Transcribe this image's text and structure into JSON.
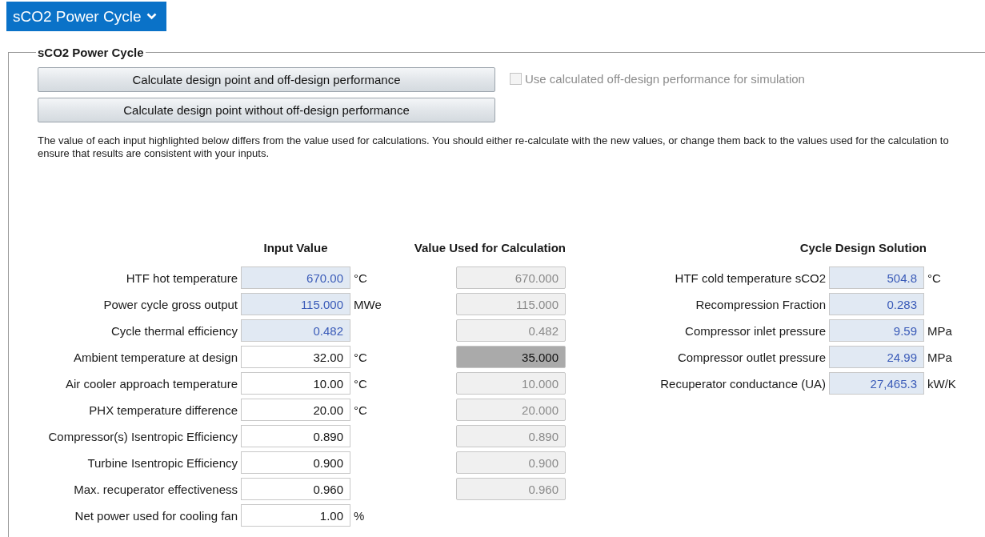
{
  "header_tab": {
    "label": "sCO2 Power Cycle",
    "selected": true
  },
  "group": {
    "title": "sCO2 Power Cycle"
  },
  "buttons": [
    "Calculate design point and off-design performance",
    "Calculate design point without off-design performance"
  ],
  "option": {
    "label": "Use calculated off-design performance for simulation",
    "checked": false,
    "disabled": true
  },
  "notice": "The value of each input highlighted below differs from the value used for calculations. You should either re-calculate with the new values, or change them back to the values used for the calculation to ensure that results are consistent with your inputs.",
  "inputs": {
    "columns": [
      "Input Value",
      "Value Used for Calculation"
    ],
    "rows": [
      {
        "label": "HTF hot temperature",
        "value": "670.00",
        "unit": "°C",
        "highlighted": true,
        "calc_value": "670.000",
        "differs": false
      },
      {
        "label": "Power cycle gross output",
        "value": "115.000",
        "unit": "MWe",
        "highlighted": true,
        "calc_value": "115.000",
        "differs": false
      },
      {
        "label": "Cycle thermal efficiency",
        "value": "0.482",
        "highlighted": true,
        "calc_value": "0.482",
        "differs": false
      },
      {
        "label": "Ambient temperature at design",
        "value": "32.00",
        "unit": "°C",
        "highlighted": false,
        "calc_value": "35.000",
        "differs": true
      },
      {
        "label": "Air cooler approach temperature",
        "value": "10.00",
        "unit": "°C",
        "highlighted": false,
        "calc_value": "10.000",
        "differs": false
      },
      {
        "label": "PHX temperature difference",
        "value": "20.00",
        "unit": "°C",
        "highlighted": false,
        "calc_value": "20.000",
        "differs": false
      },
      {
        "label": "Compressor(s) Isentropic Efficiency",
        "value": "0.890",
        "highlighted": false,
        "calc_value": "0.890",
        "differs": false
      },
      {
        "label": "Turbine Isentropic Efficiency",
        "value": "0.900",
        "highlighted": false,
        "calc_value": "0.900",
        "differs": false
      },
      {
        "label": "Max. recuperator effectiveness",
        "value": "0.960",
        "highlighted": false,
        "calc_value": "0.960",
        "differs": false
      },
      {
        "label": "Net power used for cooling fan",
        "value": "1.00",
        "unit": "%",
        "highlighted": false
      }
    ]
  },
  "solution": {
    "title": "Cycle Design Solution",
    "rows": [
      {
        "label": "HTF cold temperature sCO2",
        "value": "504.8",
        "unit": "°C"
      },
      {
        "label": "Recompression Fraction",
        "value": "0.283"
      },
      {
        "label": "Compressor inlet pressure",
        "value": "9.59",
        "unit": "MPa"
      },
      {
        "label": "Compressor outlet pressure",
        "value": "24.99",
        "unit": "MPa"
      },
      {
        "label": "Recuperator conductance (UA)",
        "value": "27,465.3",
        "unit": "kW/K"
      }
    ]
  }
}
